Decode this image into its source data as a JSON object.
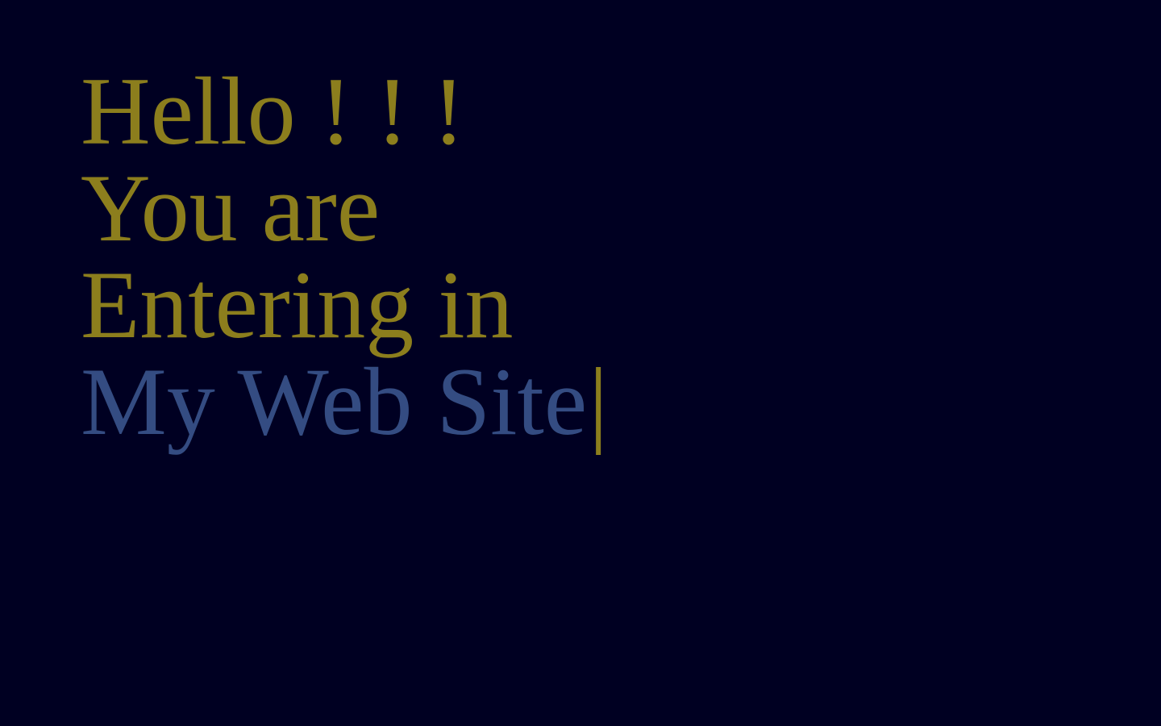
{
  "hero": {
    "line1": "Hello ! ! !",
    "line2": "You are",
    "line3": "Entering in",
    "typed_text": "My Web Site",
    "cursor": "|"
  },
  "colors": {
    "background": "#000022",
    "gold_text": "#8c7e1d",
    "blue_text": "#344c82"
  }
}
